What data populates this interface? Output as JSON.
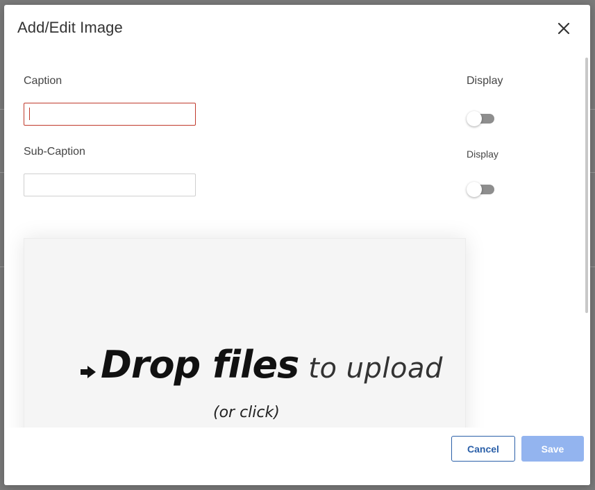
{
  "dialog": {
    "title": "Add/Edit Image",
    "close_icon": "close-icon"
  },
  "form": {
    "caption_label": "Caption",
    "caption_value": "",
    "subcaption_label": "Sub-Caption",
    "subcaption_value": "",
    "display_label_1": "Display",
    "display_label_2": "Display",
    "display_1_on": false,
    "display_2_on": false
  },
  "dropzone": {
    "arrow_icon": "arrow-right-icon",
    "strong_text": "Drop files",
    "light_text": "to upload",
    "sub_text": "(or click)"
  },
  "footer": {
    "cancel_label": "Cancel",
    "save_label": "Save"
  },
  "colors": {
    "primary": "#2a5fa8",
    "primary_disabled": "#93b4ef",
    "error": "#c0392b",
    "toggle_off": "#8e8e8e"
  }
}
